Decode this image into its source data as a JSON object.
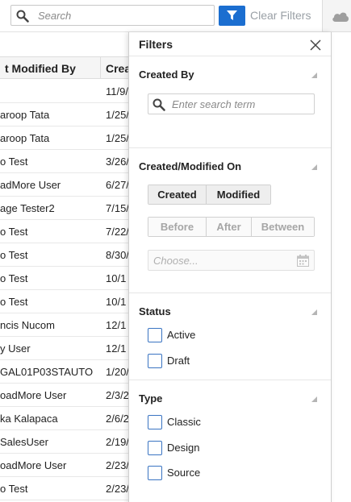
{
  "toolbar": {
    "search_placeholder": "Search",
    "clear_filters": "Clear Filters"
  },
  "table": {
    "headers": [
      "t Modified By",
      "Crea"
    ],
    "rows": [
      {
        "modified_by": "",
        "created": "11/9/"
      },
      {
        "modified_by": "aroop Tata",
        "created": "1/25/"
      },
      {
        "modified_by": "aroop Tata",
        "created": "1/25/"
      },
      {
        "modified_by": "o Test",
        "created": "3/26/"
      },
      {
        "modified_by": "adMore User",
        "created": "6/27/"
      },
      {
        "modified_by": "age Tester2",
        "created": "7/15/"
      },
      {
        "modified_by": "o Test",
        "created": "7/22/"
      },
      {
        "modified_by": "o Test",
        "created": "8/30/"
      },
      {
        "modified_by": "o Test",
        "created": "10/1"
      },
      {
        "modified_by": "o Test",
        "created": "10/1"
      },
      {
        "modified_by": "ncis Nucom",
        "created": "12/1"
      },
      {
        "modified_by": "y User",
        "created": "12/1"
      },
      {
        "modified_by": "GAL01P03STAUTO",
        "created": "1/20/"
      },
      {
        "modified_by": "oadMore User",
        "created": "2/3/2"
      },
      {
        "modified_by": "ka Kalapaca",
        "created": "2/6/2"
      },
      {
        "modified_by": "SalesUser",
        "created": "2/19/"
      },
      {
        "modified_by": "oadMore User",
        "created": "2/23/"
      },
      {
        "modified_by": "o Test",
        "created": "2/23/"
      }
    ]
  },
  "filters": {
    "title": "Filters",
    "created_by": {
      "title": "Created By",
      "search_placeholder": "Enter search term"
    },
    "created_modified_on": {
      "title": "Created/Modified On",
      "mode_buttons": [
        "Created",
        "Modified"
      ],
      "range_buttons": [
        "Before",
        "After",
        "Between"
      ],
      "date_placeholder": "Choose..."
    },
    "status": {
      "title": "Status",
      "options": [
        "Active",
        "Draft"
      ]
    },
    "type": {
      "title": "Type",
      "options": [
        "Classic",
        "Design",
        "Source"
      ]
    }
  },
  "colors": {
    "accent": "#1b6ed0",
    "checkbox_border": "#3a74c2"
  }
}
